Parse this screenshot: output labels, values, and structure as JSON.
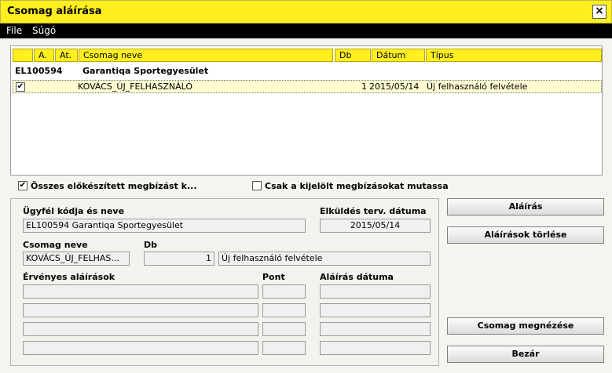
{
  "window": {
    "title": "Csomag aláírása",
    "close_glyph": "×"
  },
  "menu": {
    "file": "File",
    "help": "Súgó"
  },
  "grid": {
    "columns": [
      "A.",
      "At.",
      "Csomag neve",
      "Db",
      "Dátum",
      "Típus"
    ],
    "group": {
      "code": "EL100594",
      "name": "Garantiqa Sportegyesület"
    },
    "row": {
      "checked": "✔",
      "name": "KOVÁCS_ÚJ_FELHASZNÁLÓ",
      "db": "1",
      "date": "2015/05/14",
      "type": "Új felhasználó felvétele"
    }
  },
  "options": {
    "all_prepared": {
      "label": "Összes előkészített megbízást k...",
      "checked": "✔"
    },
    "only_selected": {
      "label": "Csak a kijelölt megbízásokat mutassa"
    }
  },
  "form": {
    "client_label": "Ügyfél kódja és neve",
    "client_value": "EL100594  Garantiqa Sportegyesület",
    "send_date_label": "Elküldés terv. dátuma",
    "send_date_value": "2015/05/14",
    "package_label": "Csomag neve",
    "package_value": "KOVÁCS_ÚJ_FELHAS...",
    "db_label": "Db",
    "db_value": "1",
    "type_value": "Új felhasználó felvétele",
    "valid_sigs_label": "Érvényes aláírások",
    "point_label": "Pont",
    "sig_date_label": "Aláírás dátuma"
  },
  "buttons": {
    "sign": "Aláírás",
    "delete_sigs": "Aláírások törlése",
    "view_package": "Csomag megnézése",
    "close": "Bezár"
  }
}
